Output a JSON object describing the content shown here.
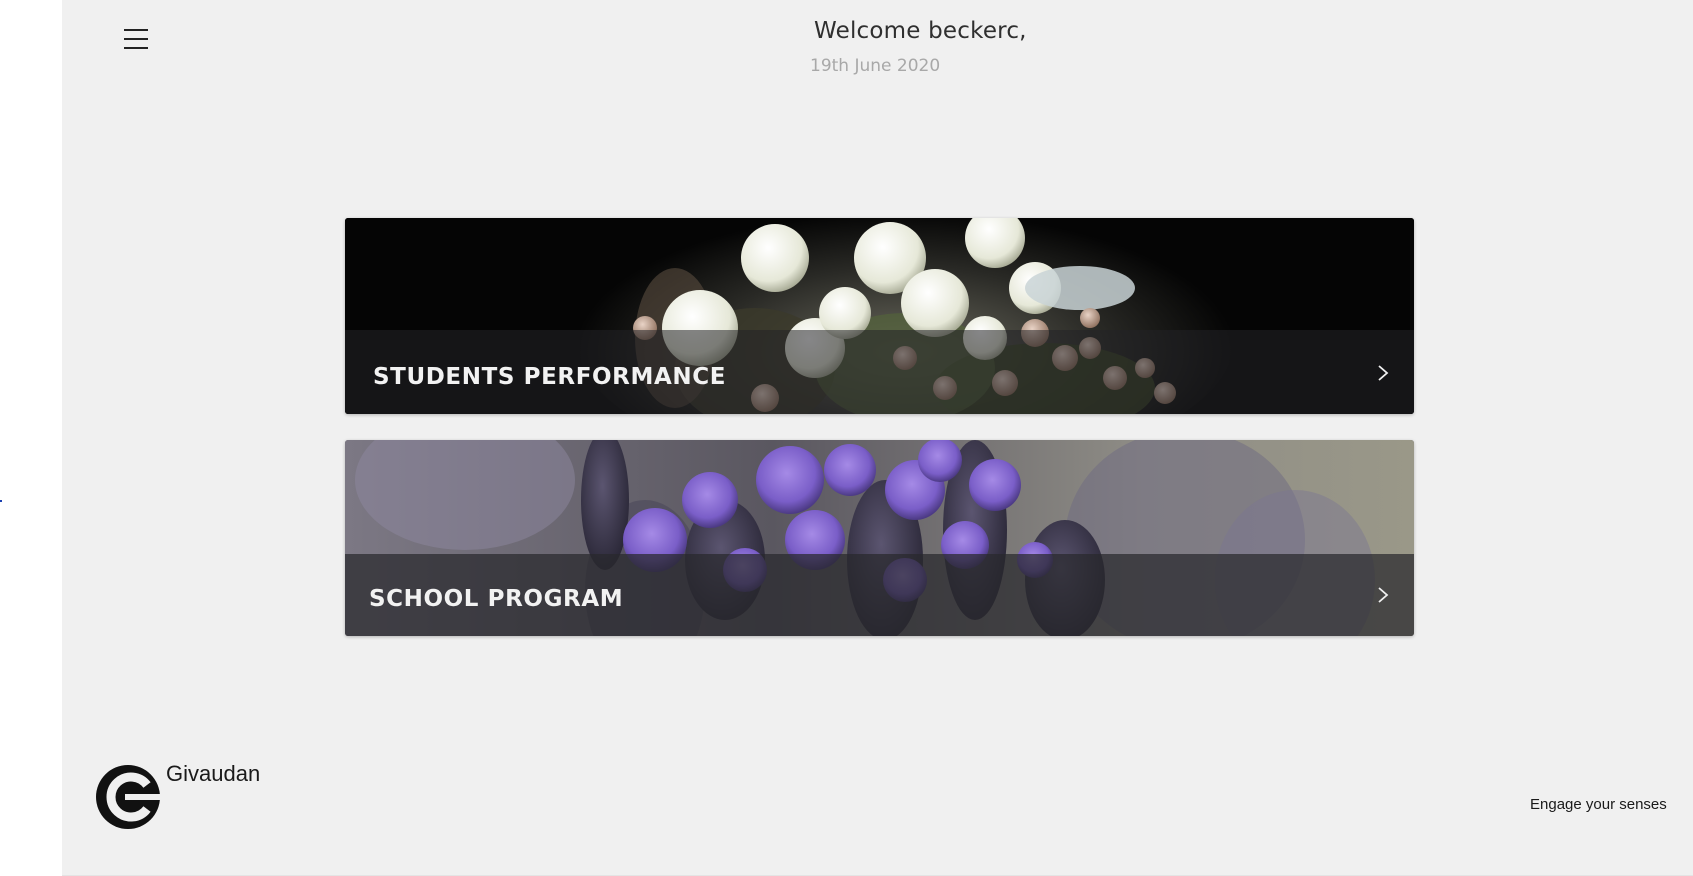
{
  "header": {
    "welcome": "Welcome beckerc,",
    "date": "19th June 2020"
  },
  "menu": {
    "icon": "hamburger-menu-icon"
  },
  "cards": [
    {
      "title": "STUDENTS PERFORMANCE",
      "image": "white-flowers-image",
      "icon": "chevron-right-icon"
    },
    {
      "title": "SCHOOL PROGRAM",
      "image": "lavender-flowers-image",
      "icon": "chevron-right-icon"
    }
  ],
  "footer": {
    "brand": "Givaudan",
    "logo_icon": "givaudan-logo-icon",
    "tagline": "Engage your senses"
  },
  "colors": {
    "background": "#f0f0f0",
    "text": "#2f2f2f",
    "date_text": "#a8a8a8",
    "card_band": "#232326",
    "card_text": "#f2f2f2"
  }
}
